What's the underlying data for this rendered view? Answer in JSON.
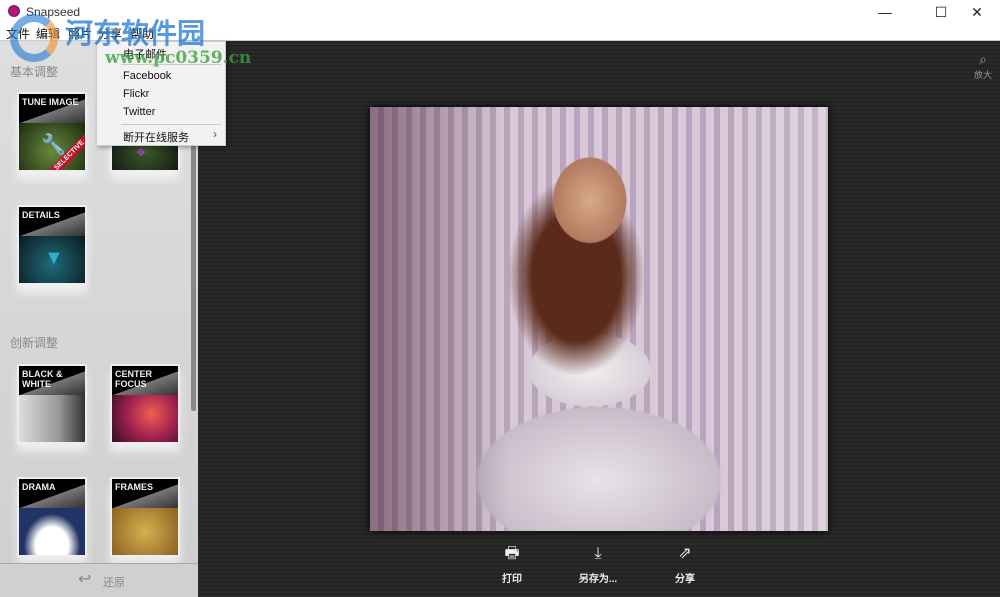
{
  "window": {
    "title": "Snapseed",
    "minimize": "—",
    "maximize": "☐",
    "close": "✕"
  },
  "menu": [
    "文件",
    "编辑",
    "照片",
    "分享",
    "帮助"
  ],
  "share_menu": {
    "items": [
      "电子邮件",
      "Facebook",
      "Flickr",
      "Twitter"
    ],
    "submenu": "断开在线服务",
    "submenu_arrow": "›"
  },
  "sidebar": {
    "basic_label": "基本调整",
    "creative_label": "创新调整",
    "basic_tiles": [
      {
        "label": "TUNE IMAGE"
      },
      {
        "label": ""
      },
      {
        "label": "DETAILS"
      }
    ],
    "creative_tiles": [
      {
        "label": "BLACK & WHITE"
      },
      {
        "label": "CENTER FOCUS"
      },
      {
        "label": "DRAMA"
      },
      {
        "label": "FRAMES"
      }
    ],
    "selective_badge": "SELECTIVE",
    "restore": "还原"
  },
  "main": {
    "zoom_label": "放大",
    "tools": [
      {
        "icon": "print-icon",
        "label": "打印"
      },
      {
        "icon": "download-icon",
        "label": "另存为..."
      },
      {
        "icon": "share-icon",
        "label": "分享"
      }
    ]
  },
  "watermark": {
    "text": "河东软件园",
    "url": "www.pc0359.cn"
  }
}
